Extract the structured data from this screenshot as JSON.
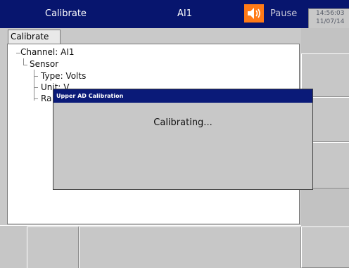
{
  "header": {
    "title": "Calibrate",
    "channel": "AI1",
    "status": "Pause",
    "time": "14:56:03",
    "date": "11/07/14"
  },
  "tab": {
    "label": "Calibrate"
  },
  "tree": {
    "channel": "Channel: AI1",
    "sensor": "Sensor",
    "type": "Type: Volts",
    "unit": "Unit: V",
    "range_partial": "Ra"
  },
  "dialog": {
    "title": "Upper AD Calibration",
    "message": "Calibrating..."
  },
  "colors": {
    "header_bg": "#07156e",
    "dialog_titlebar": "#0a1a78",
    "speaker_bg": "#ff7a17",
    "panel_bg": "#c9c9c9"
  },
  "icons": {
    "speaker": "speaker-icon"
  }
}
